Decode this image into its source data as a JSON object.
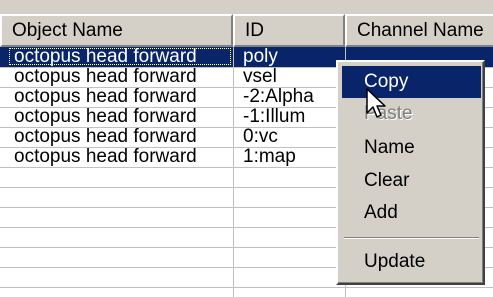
{
  "columns": [
    "Object Name",
    "ID",
    "Channel Name"
  ],
  "rows": [
    {
      "object": "octopus head forward",
      "id": "poly"
    },
    {
      "object": "octopus head forward",
      "id": "vsel"
    },
    {
      "object": "octopus head forward",
      "id": "-2:Alpha"
    },
    {
      "object": "octopus head forward",
      "id": "-1:Illum"
    },
    {
      "object": "octopus head forward",
      "id": "0:vc"
    },
    {
      "object": "octopus head forward",
      "id": "1:map"
    }
  ],
  "selected_row": 0,
  "context_menu": {
    "items": [
      {
        "label": "Copy",
        "state": "highlighted"
      },
      {
        "label": "Paste",
        "state": "disabled"
      },
      {
        "label": "Name",
        "state": "normal"
      },
      {
        "label": "Clear",
        "state": "normal"
      },
      {
        "label": "Add",
        "state": "normal"
      },
      {
        "label": "Update",
        "state": "normal"
      }
    ]
  },
  "colors": {
    "selection": "#0a246a",
    "face": "#d4d0c8",
    "gridline": "#c0c0c0"
  },
  "icons": {
    "cursor": "arrow-pointer-icon"
  }
}
